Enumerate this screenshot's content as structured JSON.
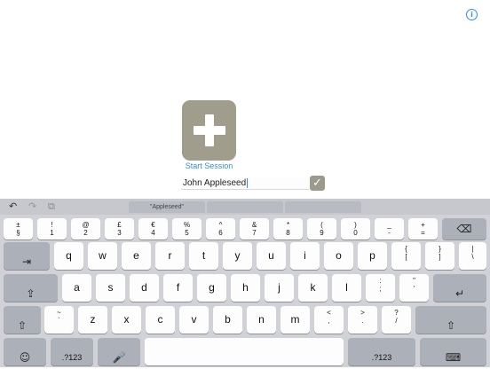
{
  "header": {
    "info_icon": "info-icon",
    "info_symbol": "i"
  },
  "start": {
    "label": "Start Session",
    "icon": "plus-icon"
  },
  "name_field": {
    "value": "John Appleseed"
  },
  "confirm": {
    "icon": "checkmark-icon",
    "symbol": "✓"
  },
  "keyboard": {
    "toolbar": {
      "undo": "↶",
      "redo": "↷",
      "paste": "⧉"
    },
    "suggestions": [
      "\"Appleseed\"",
      "",
      ""
    ],
    "number_row": [
      [
        "±",
        "§"
      ],
      [
        "!",
        "1"
      ],
      [
        "@",
        "2"
      ],
      [
        "£",
        "3"
      ],
      [
        "€",
        "4"
      ],
      [
        "%",
        "5"
      ],
      [
        "^",
        "6"
      ],
      [
        "&",
        "7"
      ],
      [
        "*",
        "8"
      ],
      [
        "(",
        "9"
      ],
      [
        ")",
        "0"
      ],
      [
        "_",
        "-"
      ],
      [
        "+",
        "="
      ]
    ],
    "row1": [
      "q",
      "w",
      "e",
      "r",
      "t",
      "y",
      "u",
      "i",
      "o",
      "p"
    ],
    "row1_extra": [
      [
        "{",
        "["
      ],
      [
        "}",
        "]"
      ],
      [
        "|",
        "\\"
      ]
    ],
    "row2": [
      "a",
      "s",
      "d",
      "f",
      "g",
      "h",
      "j",
      "k",
      "l"
    ],
    "row2_extra": [
      [
        ":",
        ";"
      ],
      [
        "\"",
        "'"
      ]
    ],
    "row3_extra_left": [
      "~",
      "`"
    ],
    "row3": [
      "z",
      "x",
      "c",
      "v",
      "b",
      "n",
      "m"
    ],
    "row3_extra_right": [
      [
        "<",
        ","
      ],
      [
        ">",
        "."
      ],
      [
        "?",
        "/"
      ]
    ],
    "labels": {
      "delete": "⌫",
      "tab": "⇥",
      "caps": "⇪",
      "return": "↵",
      "shift": "⇧",
      "emoji": "☺",
      "numbers": ".?123",
      "mic": "🎤",
      "hide": "⌨"
    }
  }
}
